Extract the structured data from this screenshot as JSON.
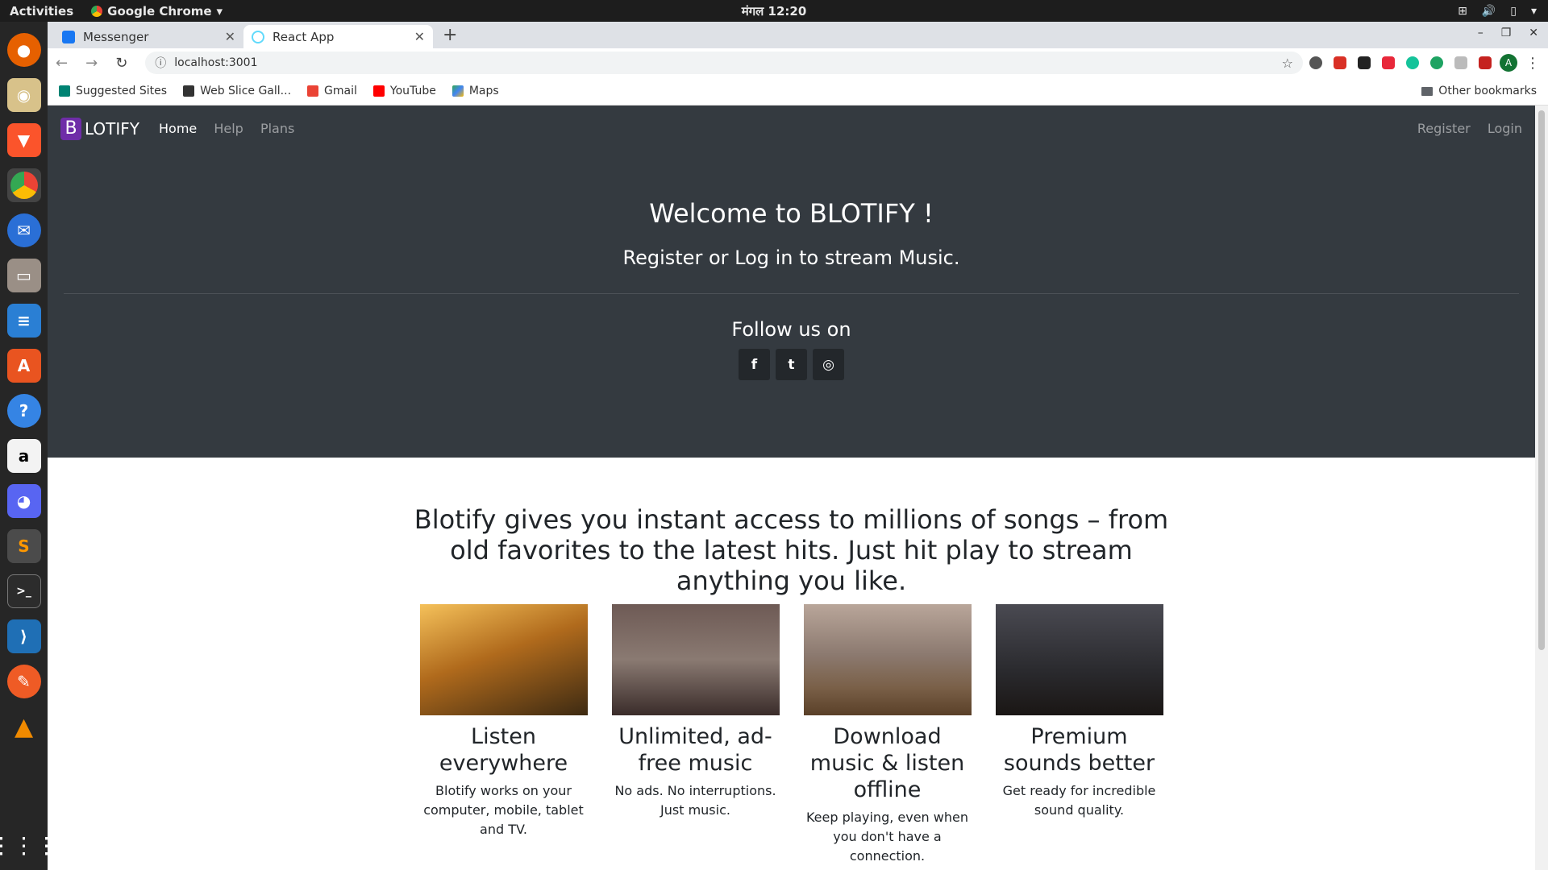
{
  "os": {
    "activities": "Activities",
    "app_menu": "Google Chrome",
    "clock": "मंगल 12:20",
    "dock_apps": [
      "firefox-icon",
      "rhythmbox-icon",
      "brave-icon",
      "chrome-icon",
      "thunderbird-icon",
      "files-icon",
      "writer-icon",
      "software-icon",
      "help-icon",
      "amazon-icon",
      "discord-icon",
      "sublime-icon",
      "terminal-icon",
      "vscode-icon",
      "postman-icon",
      "vlc-icon"
    ]
  },
  "browser": {
    "tabs": [
      {
        "title": "Messenger",
        "active": false
      },
      {
        "title": "React App",
        "active": true
      }
    ],
    "url": "localhost:3001",
    "bookmarks": [
      "Suggested Sites",
      "Web Slice Gall...",
      "Gmail",
      "YouTube",
      "Maps"
    ],
    "other_bookmarks": "Other bookmarks",
    "profile_initial": "A"
  },
  "site": {
    "brand_letter": "B",
    "brand_rest": "LOTIFY",
    "nav": [
      "Home",
      "Help",
      "Plans"
    ],
    "nav_right": [
      "Register",
      "Login"
    ],
    "hero_title": "Welcome to BLOTIFY !",
    "hero_lead": "Register or Log in to stream Music.",
    "follow": "Follow us on",
    "social": [
      "f",
      "t",
      "◎"
    ],
    "tagline": "Blotify gives you instant access to millions of songs – from old favorites to the latest hits. Just hit play to stream anything you like.",
    "features": [
      {
        "title": "Listen everywhere",
        "text": "Blotify works on your computer, mobile, tablet and TV."
      },
      {
        "title": "Unlimited, ad-free music",
        "text": "No ads. No interruptions. Just music."
      },
      {
        "title": "Download music & listen offline",
        "text": "Keep playing, even when you don't have a connection."
      },
      {
        "title": "Premium sounds better",
        "text": "Get ready for incredible sound quality."
      }
    ]
  },
  "colors": {
    "hero_bg": "#343a40",
    "brand_accent": "#6f2da8",
    "dock_bg": "#262626"
  }
}
